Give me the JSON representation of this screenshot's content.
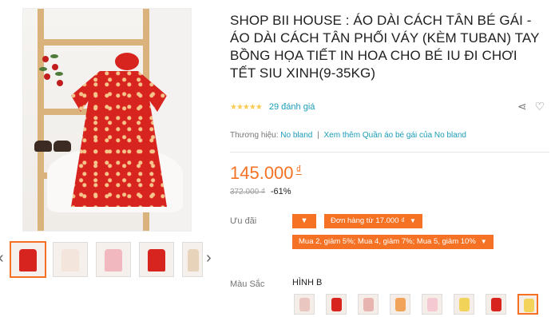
{
  "product": {
    "title": "SHOP BII HOUSE : ÁO DÀI CÁCH TÂN BÉ GÁI - ÁO DÀI CÁCH TÂN PHỐI VÁY (KÈM TUBAN) TAY BỒNG HỌA TIẾT IN HOA CHO BÉ IU ĐI CHƠI TẾT SIU XINH(9-35KG)",
    "rating_stars": "★★★★★",
    "rating_count": "29 đánh giá",
    "brand_label": "Thương hiệu:",
    "brand_name": "No bland",
    "separator": "|",
    "brand_more": "Xem thêm Quần áo bé gái của No bland",
    "price": "145.000",
    "currency": "₫",
    "old_price": "372.000 ₫",
    "discount": "-61%"
  },
  "promotions": {
    "label": "Ưu đãi",
    "items": [
      "Đơn hàng từ 17.000 ₫",
      "Mua 2, giảm 5%; Mua 4, giảm 7%; Mua 5, giảm 10%"
    ]
  },
  "variants": {
    "label": "Màu Sắc",
    "selected": "HÌNH B",
    "swatch_count": 8
  },
  "icons": {
    "share": "share-icon",
    "like": "heart-icon",
    "prev": "chevron-left-icon",
    "next": "chevron-right-icon",
    "dropdown": "caret-down-icon"
  },
  "colors": {
    "accent": "#f57224",
    "link": "#1a9cb7",
    "star": "#faca51",
    "dress_red": "#d8241f"
  }
}
